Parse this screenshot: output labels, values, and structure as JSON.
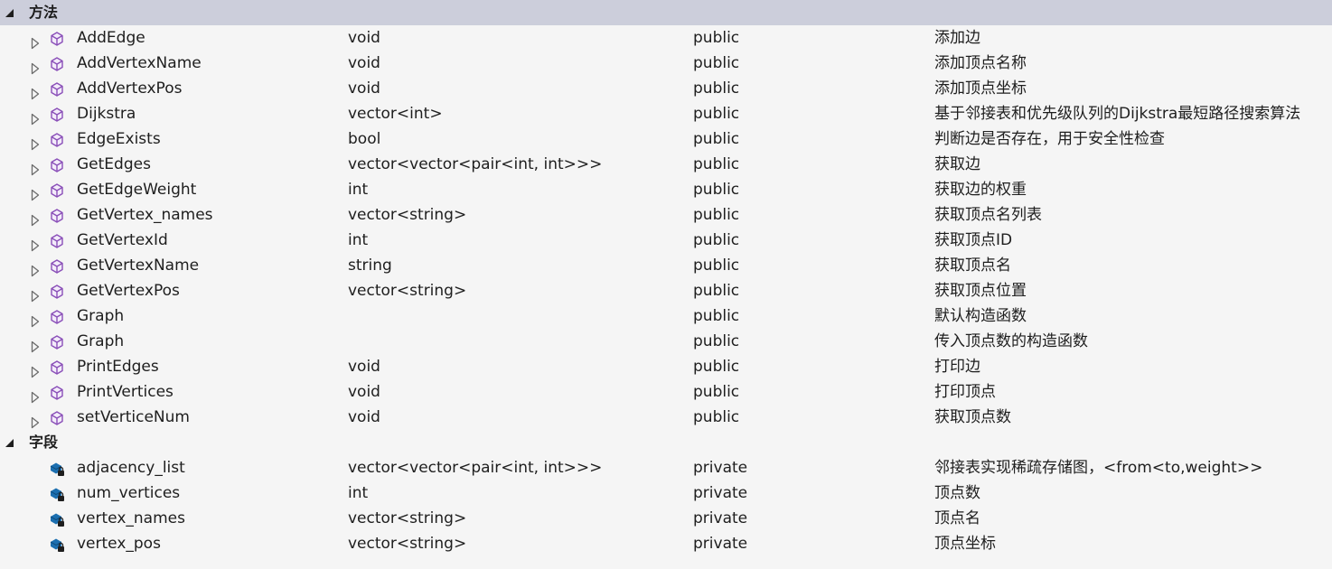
{
  "sections": [
    {
      "title": "方法",
      "kind": "method",
      "expanded": true,
      "rows": [
        {
          "name": "AddEdge",
          "type": "void",
          "access": "public",
          "desc": "添加边"
        },
        {
          "name": "AddVertexName",
          "type": "void",
          "access": "public",
          "desc": "添加顶点名称"
        },
        {
          "name": "AddVertexPos",
          "type": "void",
          "access": "public",
          "desc": "添加顶点坐标"
        },
        {
          "name": "Dijkstra",
          "type": "vector<int>",
          "access": "public",
          "desc": "基于邻接表和优先级队列的Dijkstra最短路径搜索算法"
        },
        {
          "name": "EdgeExists",
          "type": "bool",
          "access": "public",
          "desc": "判断边是否存在，用于安全性检查"
        },
        {
          "name": "GetEdges",
          "type": "vector<vector<pair<int, int>>>",
          "access": "public",
          "desc": "获取边"
        },
        {
          "name": "GetEdgeWeight",
          "type": "int",
          "access": "public",
          "desc": "获取边的权重"
        },
        {
          "name": "GetVertex_names",
          "type": "vector<string>",
          "access": "public",
          "desc": "获取顶点名列表"
        },
        {
          "name": "GetVertexId",
          "type": "int",
          "access": "public",
          "desc": "获取顶点ID"
        },
        {
          "name": "GetVertexName",
          "type": "string",
          "access": "public",
          "desc": "获取顶点名"
        },
        {
          "name": "GetVertexPos",
          "type": "vector<string>",
          "access": "public",
          "desc": "获取顶点位置"
        },
        {
          "name": "Graph",
          "type": "",
          "access": "public",
          "desc": "默认构造函数"
        },
        {
          "name": "Graph",
          "type": "",
          "access": "public",
          "desc": "传入顶点数的构造函数"
        },
        {
          "name": "PrintEdges",
          "type": "void",
          "access": "public",
          "desc": "打印边"
        },
        {
          "name": "PrintVertices",
          "type": "void",
          "access": "public",
          "desc": "打印顶点"
        },
        {
          "name": "setVerticeNum",
          "type": "void",
          "access": "public",
          "desc": "获取顶点数"
        }
      ]
    },
    {
      "title": "字段",
      "kind": "field",
      "expanded": true,
      "rows": [
        {
          "name": "adjacency_list",
          "type": "vector<vector<pair<int, int>>>",
          "access": "private",
          "desc": "邻接表实现稀疏存储图，<from<to,weight>>"
        },
        {
          "name": "num_vertices",
          "type": "int",
          "access": "private",
          "desc": "顶点数"
        },
        {
          "name": "vertex_names",
          "type": "vector<string>",
          "access": "private",
          "desc": "顶点名"
        },
        {
          "name": "vertex_pos",
          "type": "vector<string>",
          "access": "private",
          "desc": "顶点坐标"
        }
      ]
    }
  ],
  "icons": {
    "section_toggle": "triangle-expanded-icon",
    "row_expander": "triangle-collapsed-icon",
    "method": "method-cube-icon",
    "field": "private-field-icon"
  },
  "colors": {
    "header_bg": "#cccedb",
    "page_bg": "#f5f5f5",
    "method_icon": "#8a4fb8",
    "field_icon": "#1c6fb0"
  }
}
